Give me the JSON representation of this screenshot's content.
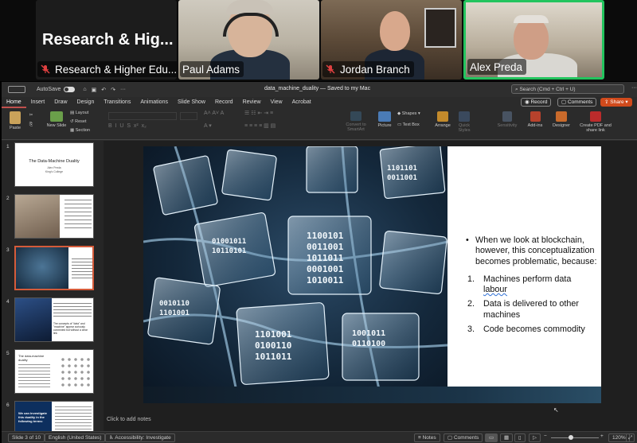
{
  "meeting": {
    "tiles": [
      {
        "title": "Research & Hig...",
        "name": "Research & Higher Edu...",
        "muted": true
      },
      {
        "name": "Paul Adams",
        "muted": false
      },
      {
        "name": "Jordan Branch",
        "muted": true
      },
      {
        "name": "Alex Preda",
        "muted": false,
        "active_speaker": true
      }
    ]
  },
  "app": {
    "autosave": "AutoSave",
    "doc_title": "data_machine_duality — Saved to my Mac",
    "search_placeholder": "Search (Cmd + Ctrl + U)",
    "tabs": [
      "Home",
      "Insert",
      "Draw",
      "Design",
      "Transitions",
      "Animations",
      "Slide Show",
      "Record",
      "Review",
      "View",
      "Acrobat"
    ],
    "active_tab": "Home",
    "record_btn": "Record",
    "comments_btn": "Comments",
    "share_btn": "Share"
  },
  "ribbon": {
    "paste": "Paste",
    "new_slide": "New Slide",
    "layout": "Layout",
    "reset": "Reset",
    "section": "Section",
    "convert": "Convert to SmartArt",
    "picture": "Picture",
    "shapes": "Shapes",
    "textbox": "Text Box",
    "arrange": "Arrange",
    "quick_styles": "Quick Styles",
    "sensitivity": "Sensitivity",
    "addins": "Add-ins",
    "designer": "Designer",
    "create_pdf": "Create PDF and share link"
  },
  "thumbnails": [
    {
      "num": "1",
      "title": "The Data-Machine Duality",
      "sub1": "Alex Preda",
      "sub2": "King's College"
    },
    {
      "num": "2"
    },
    {
      "num": "3",
      "selected": true
    },
    {
      "num": "4",
      "text": "The concepts of \"data\" and \"machine\" appear curiously connected but without a clear link"
    },
    {
      "num": "5",
      "title": "The data-machine duality"
    },
    {
      "num": "6",
      "text": "We can investigate this duality in the following terms:"
    }
  ],
  "slide": {
    "bullet": "When we look at blockchain, however, this conceptualization becomes problematic, because:",
    "items": [
      {
        "n": "1.",
        "text_a": "Machines perform data ",
        "text_b": "labour"
      },
      {
        "n": "2.",
        "text_a": "Data is delivered to other machines",
        "text_b": ""
      },
      {
        "n": "3.",
        "text_a": "Code becomes commodity",
        "text_b": ""
      }
    ],
    "cube_code": [
      "1100101",
      "0011001",
      "1011011",
      "0001001",
      "1010011",
      "0100110",
      "01001011",
      "1101101"
    ]
  },
  "notes_hint": "Click to add notes",
  "status": {
    "slide_of": "Slide 3 of 10",
    "language": "English (United States)",
    "accessibility": "Accessibility: Investigate",
    "notes": "Notes",
    "comments": "Comments",
    "zoom": "120%"
  },
  "colors": {
    "accent": "#d04a1c",
    "speaker_border": "#23c45e",
    "mic_off": "#e04040"
  }
}
